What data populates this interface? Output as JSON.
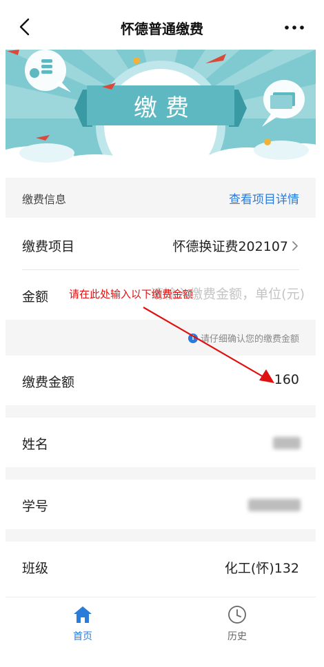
{
  "navbar": {
    "title": "怀德普通缴费"
  },
  "banner": {
    "text": "缴费"
  },
  "section": {
    "title": "缴费信息",
    "link": "查看项目详情"
  },
  "item": {
    "label": "缴费项目",
    "value": "怀德换证费202107"
  },
  "amount": {
    "label": "金额",
    "placeholder": "请输入缴费金额，单位(元)",
    "annotation": "请在此处输入以下缴费金额"
  },
  "hint": {
    "text": "请仔细确认您的缴费金额"
  },
  "pay_amount": {
    "label": "缴费金额",
    "value": "160"
  },
  "name": {
    "label": "姓名"
  },
  "student_id": {
    "label": "学号"
  },
  "class": {
    "label": "班级",
    "value": "化工(怀)132"
  },
  "tabs": [
    {
      "label": "首页",
      "icon": "home-icon",
      "active": true
    },
    {
      "label": "历史",
      "icon": "clock-icon",
      "active": false
    }
  ],
  "colors": {
    "accent": "#2b7bd8",
    "annotation": "#e01010",
    "banner": "#7fc9d0"
  }
}
